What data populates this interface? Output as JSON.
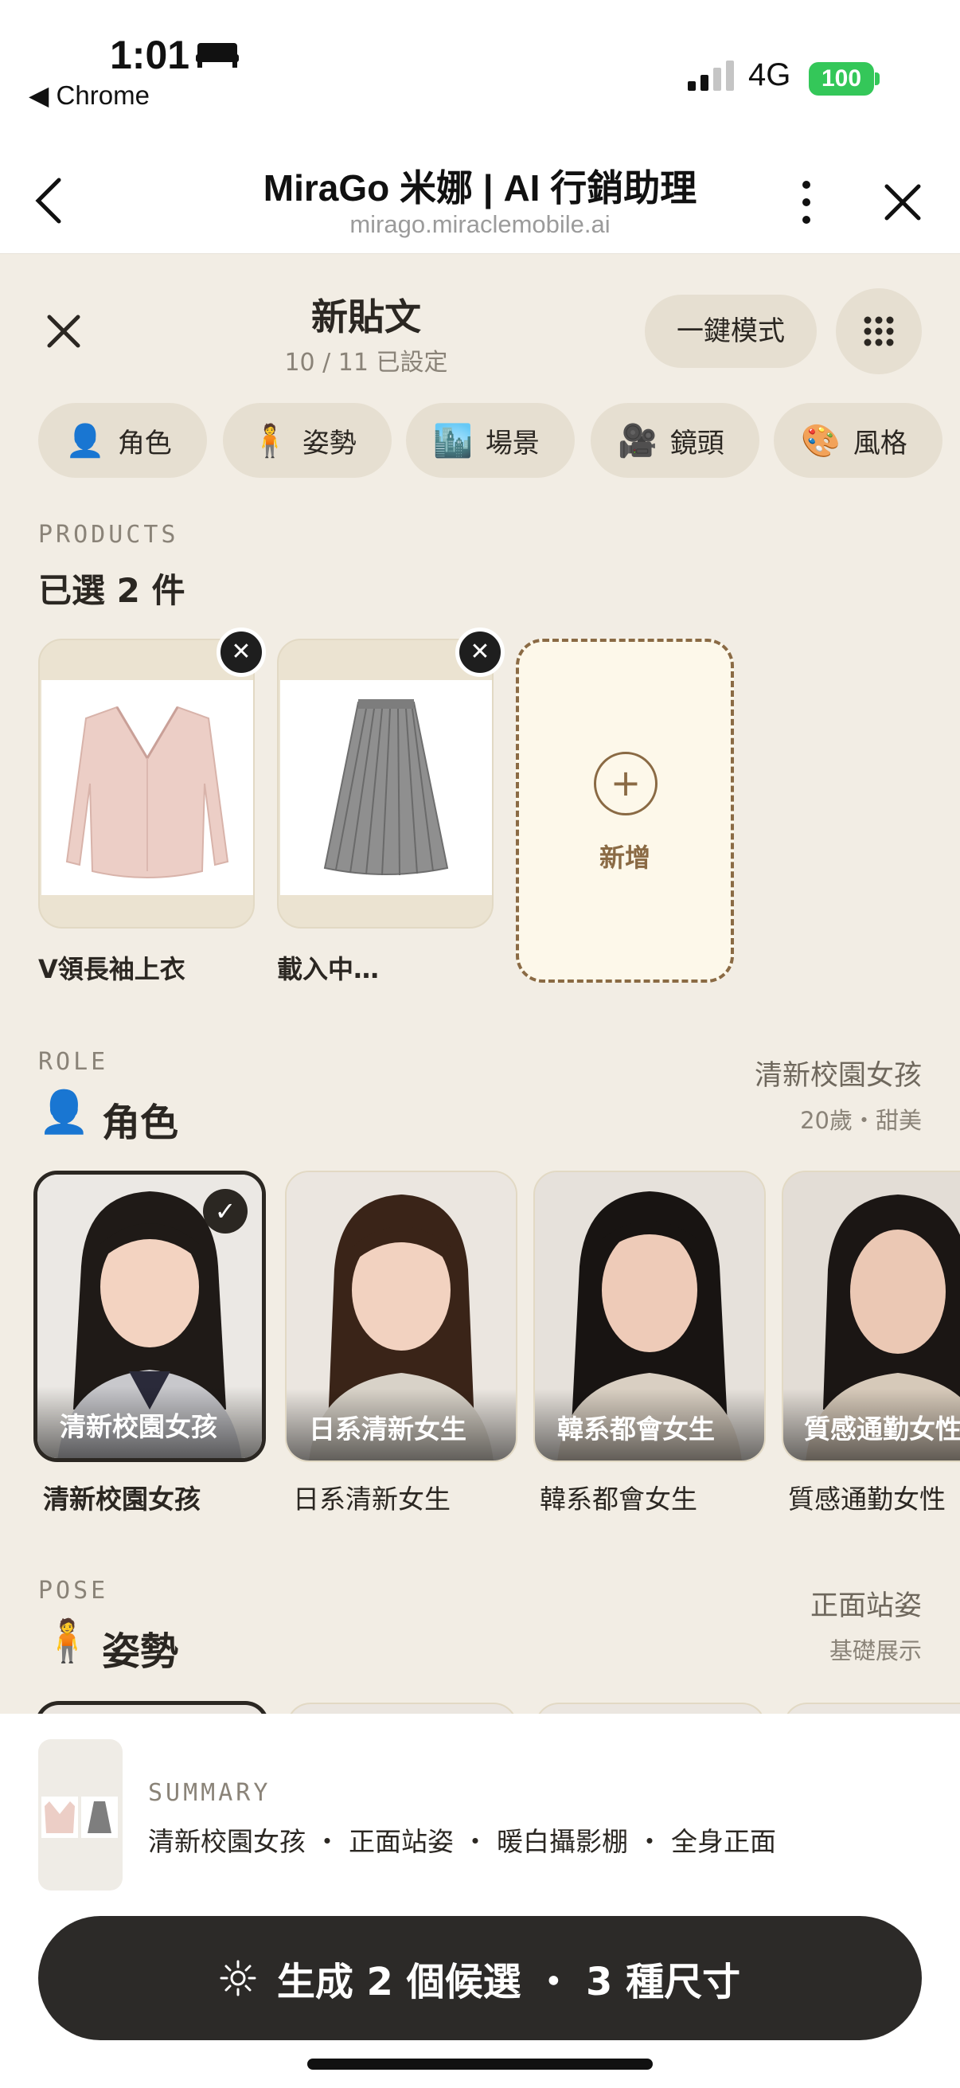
{
  "status_bar": {
    "time": "1:01",
    "back_app": "◀ Chrome",
    "network": "4G",
    "battery": "100"
  },
  "browser": {
    "title": "MiraGo 米娜 | AI 行銷助理",
    "url": "mirago.miraclemobile.ai"
  },
  "header": {
    "title": "新貼文",
    "subtitle": "10 / 11 已設定",
    "mode_button": "一鍵模式"
  },
  "chips": [
    {
      "icon": "👤",
      "label": "角色"
    },
    {
      "icon": "🧍",
      "label": "姿勢"
    },
    {
      "icon": "🏙️",
      "label": "場景"
    },
    {
      "icon": "🎥",
      "label": "鏡頭"
    },
    {
      "icon": "🎨",
      "label": "風格"
    }
  ],
  "products": {
    "label": "PRODUCTS",
    "title": "已選 2 件",
    "items": [
      {
        "name": "V領長袖上衣"
      },
      {
        "name": "載入中…"
      }
    ],
    "add_label": "新增"
  },
  "role": {
    "label": "ROLE",
    "icon": "👤",
    "title": "角色",
    "selected_name": "清新校園女孩",
    "selected_desc": "20歲・甜美",
    "cards": [
      {
        "name": "清新校園女孩",
        "selected": true
      },
      {
        "name": "日系清新女生",
        "selected": false
      },
      {
        "name": "韓系都會女生",
        "selected": false
      },
      {
        "name": "質感通勤女性",
        "selected": false
      }
    ]
  },
  "pose": {
    "label": "POSE",
    "icon": "🧍",
    "title": "姿勢",
    "selected_name": "正面站姿",
    "selected_desc": "基礎展示"
  },
  "summary": {
    "label": "SUMMARY",
    "text": "清新校園女孩 ・ 正面站姿 ・ 暖白攝影棚 ・ 全身正面"
  },
  "generate_button": "生成 2 個候選 ・ 3 種尺寸"
}
